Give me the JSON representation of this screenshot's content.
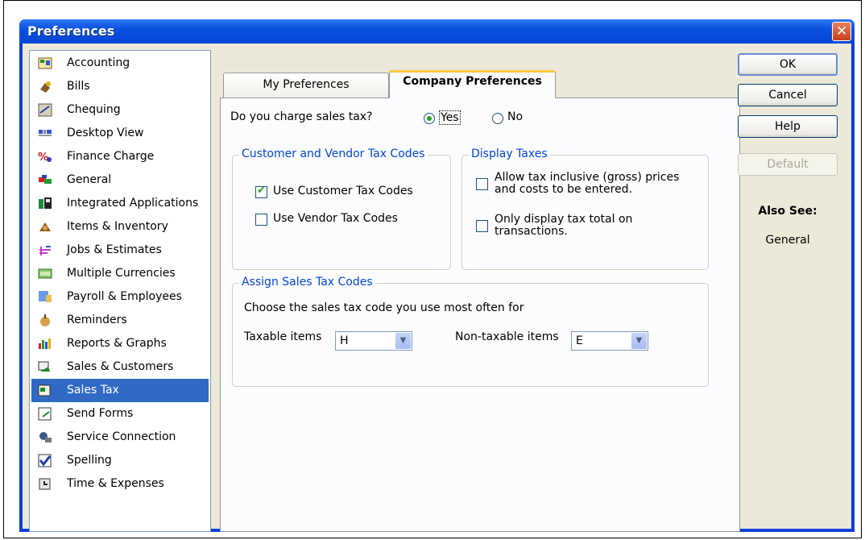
{
  "window": {
    "title": "Preferences"
  },
  "categories": [
    {
      "label": "Accounting",
      "icon": "accounting-icon"
    },
    {
      "label": "Bills",
      "icon": "bills-icon"
    },
    {
      "label": "Chequing",
      "icon": "chequing-icon"
    },
    {
      "label": "Desktop View",
      "icon": "desktop-view-icon"
    },
    {
      "label": "Finance Charge",
      "icon": "finance-charge-icon"
    },
    {
      "label": "General",
      "icon": "general-icon"
    },
    {
      "label": "Integrated Applications",
      "icon": "integrated-applications-icon"
    },
    {
      "label": "Items & Inventory",
      "icon": "items-inventory-icon"
    },
    {
      "label": "Jobs & Estimates",
      "icon": "jobs-estimates-icon"
    },
    {
      "label": "Multiple Currencies",
      "icon": "multiple-currencies-icon"
    },
    {
      "label": "Payroll & Employees",
      "icon": "payroll-employees-icon"
    },
    {
      "label": "Reminders",
      "icon": "reminders-icon"
    },
    {
      "label": "Reports & Graphs",
      "icon": "reports-graphs-icon"
    },
    {
      "label": "Sales & Customers",
      "icon": "sales-customers-icon"
    },
    {
      "label": "Sales Tax",
      "icon": "sales-tax-icon"
    },
    {
      "label": "Send Forms",
      "icon": "send-forms-icon"
    },
    {
      "label": "Service Connection",
      "icon": "service-connection-icon"
    },
    {
      "label": "Spelling",
      "icon": "spelling-icon"
    },
    {
      "label": "Time & Expenses",
      "icon": "time-expenses-icon"
    }
  ],
  "selected_category": "Sales Tax",
  "tabs": {
    "my": "My Preferences",
    "company": "Company Preferences"
  },
  "sales_tax": {
    "question": "Do you charge sales tax?",
    "yes": "Yes",
    "no": "No",
    "selected": "Yes"
  },
  "customer_vendor": {
    "title": "Customer and Vendor Tax Codes",
    "use_customer": "Use Customer Tax Codes",
    "use_customer_checked": true,
    "use_vendor": "Use Vendor Tax Codes",
    "use_vendor_checked": false
  },
  "display_taxes": {
    "title": "Display Taxes",
    "allow_inclusive_line1": "Allow tax inclusive (gross) prices",
    "allow_inclusive_line2": "and costs to be entered.",
    "allow_inclusive_checked": false,
    "only_total_line1": "Only display tax total on",
    "only_total_line2": "transactions.",
    "only_total_checked": false
  },
  "assign_codes": {
    "title": "Assign Sales Tax Codes",
    "description": "Choose the sales tax code you use most often for",
    "taxable_label": "Taxable items",
    "taxable_value": "H",
    "nontaxable_label": "Non-taxable items",
    "nontaxable_value": "E"
  },
  "buttons": {
    "ok": "OK",
    "cancel": "Cancel",
    "help": "Help",
    "default": "Default"
  },
  "also_see": {
    "title": "Also See:",
    "link": "General"
  },
  "colors": {
    "titlebar": "#0a50e0",
    "selection": "#316ac5",
    "group_title": "#0046d5",
    "tab_highlight": "#ffc83c"
  }
}
